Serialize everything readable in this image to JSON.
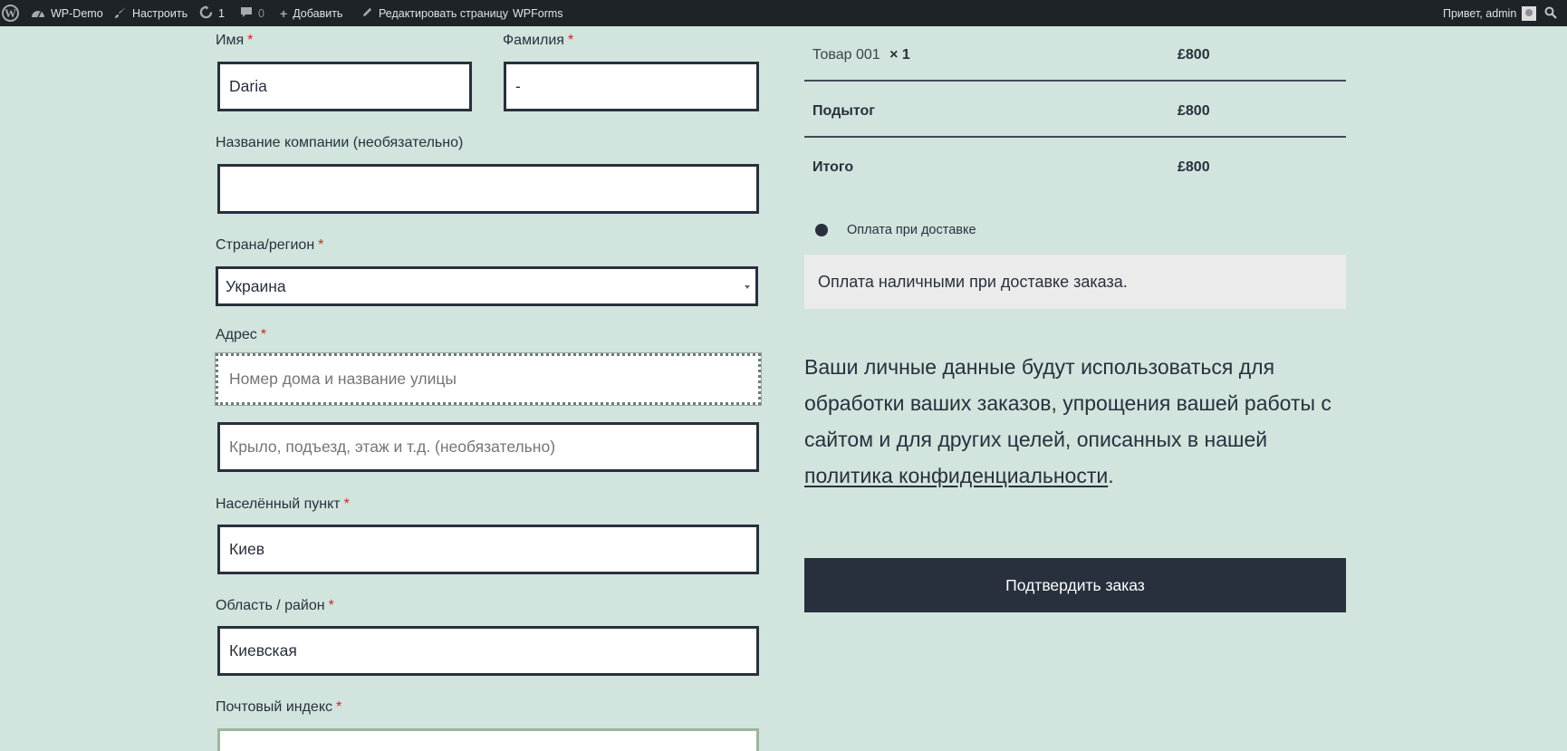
{
  "admin_bar": {
    "site_name": "WP-Demo",
    "customize": "Настроить",
    "updates_count": "1",
    "comments_count": "0",
    "new_label": "Добавить",
    "edit_page": "Редактировать страницу",
    "wpforms": "WPForms",
    "greeting": "Привет, admin"
  },
  "billing": {
    "first_name": {
      "label": "Имя",
      "required": "*",
      "value": "Daria"
    },
    "last_name": {
      "label": "Фамилия",
      "required": "*",
      "value": "-"
    },
    "company": {
      "label": "Название компании (необязательно)",
      "value": ""
    },
    "country": {
      "label": "Страна/регион",
      "required": "*",
      "value": "Украина"
    },
    "address": {
      "label": "Адрес",
      "required": "*",
      "placeholder": "Номер дома и название улицы",
      "placeholder2": "Крыло, подъезд, этаж и т.д. (необязательно)"
    },
    "city": {
      "label": "Населённый пункт",
      "required": "*",
      "value": "Киев"
    },
    "state": {
      "label": "Область / район",
      "required": "*",
      "value": "Киевская"
    },
    "postcode": {
      "label": "Почтовый индекс",
      "required": "*",
      "value": ""
    }
  },
  "order": {
    "item_name": "Товар 001",
    "item_qty": "× 1",
    "item_price": "£800",
    "subtotal_label": "Подытог",
    "subtotal_value": "£800",
    "total_label": "Итого",
    "total_value": "£800"
  },
  "payment": {
    "method": "Оплата при доставке",
    "description": "Оплата наличными при доставке заказа."
  },
  "privacy": {
    "text": "Ваши личные данные будут использоваться для обработки ваших заказов, упрощения вашей работы с сайтом и для других целей, описанных в нашей",
    "link": "политика конфиденциальности",
    "end": "."
  },
  "place_order": "Подтвердить заказ",
  "colors": {
    "background": "#d1e4dd",
    "text": "#28303d",
    "required": "#d1232a",
    "admin_bar": "#1d2327"
  }
}
